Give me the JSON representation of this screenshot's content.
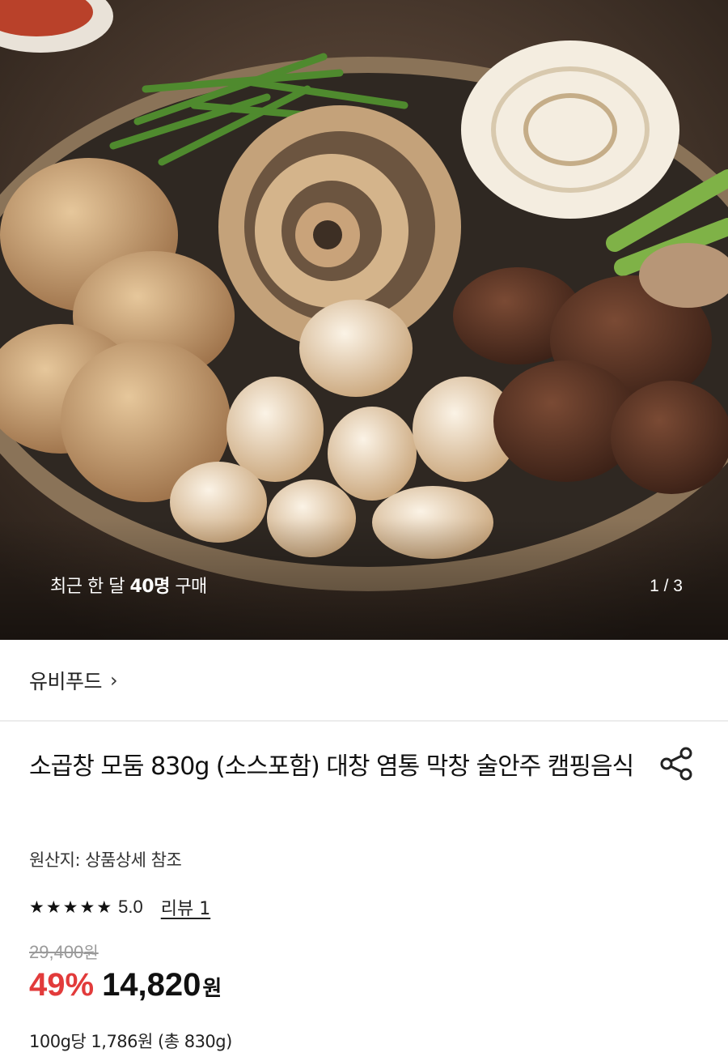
{
  "hero": {
    "recent_prefix": "최근 한 달",
    "recent_count": "40명",
    "recent_suffix": "구매",
    "counter": "1 / 3"
  },
  "brand": {
    "name": "유비푸드",
    "chevron": "›"
  },
  "product": {
    "title": "소곱창 모둠 830g (소스포함) 대창 염통 막창 술안주 캠핑음식",
    "origin": "원산지: 상품상세 참조",
    "rating": {
      "stars": 5,
      "score": "5.0",
      "review_label": "리뷰 1"
    },
    "original_price": "29,400",
    "discount": "49%",
    "price": "14,820",
    "currency": "원",
    "unit_price": "100g당 1,786원 (총 830g)"
  },
  "colors": {
    "discount": "#e23b3b",
    "strike": "#9a9a9a"
  }
}
